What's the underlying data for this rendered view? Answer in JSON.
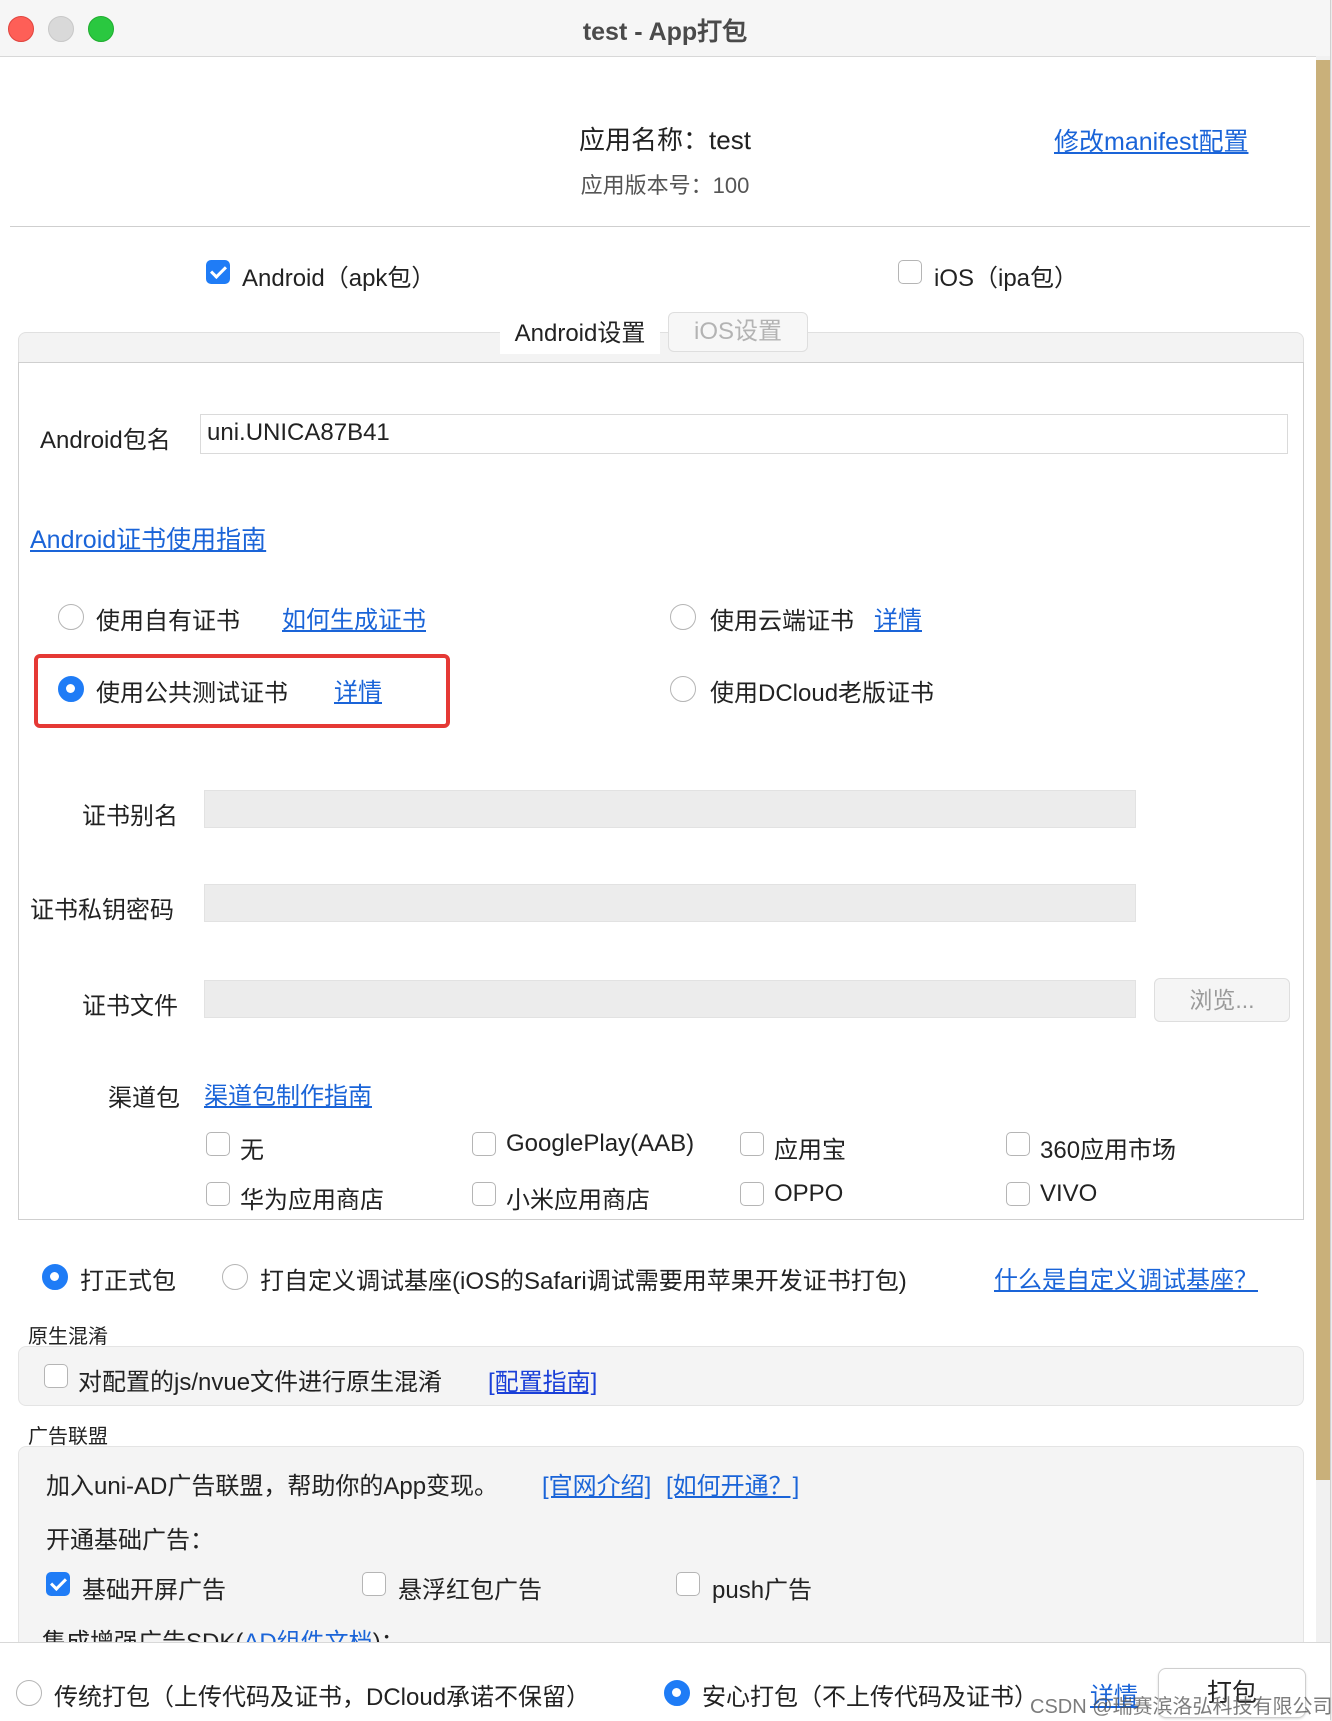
{
  "window": {
    "title": "test - App打包"
  },
  "app_info": {
    "name_line": "应用名称：test",
    "version_line": "应用版本号：100",
    "manifest_link": "修改manifest配置"
  },
  "platforms": {
    "android_label": "Android（apk包）",
    "android_checked": true,
    "ios_label": "iOS（ipa包）",
    "ios_checked": false
  },
  "tabs": {
    "android": "Android设置",
    "ios": "iOS设置"
  },
  "android": {
    "package_label": "Android包名",
    "package_value": "uni.UNICA87B41",
    "cert_guide_link": "Android证书使用指南",
    "cert_options": {
      "own": "使用自有证书",
      "own_link": "如何生成证书",
      "cloud": "使用云端证书",
      "cloud_link": "详情",
      "public_test": "使用公共测试证书",
      "public_test_link": "详情",
      "dcloud_old": "使用DCloud老版证书",
      "selected": "public_test"
    },
    "alias_label": "证书别名",
    "password_label": "证书私钥密码",
    "file_label": "证书文件",
    "browse_button": "浏览...",
    "channel_label": "渠道包",
    "channel_link": "渠道包制作指南",
    "channels": [
      {
        "label": "无",
        "checked": false
      },
      {
        "label": "GooglePlay(AAB)",
        "checked": false
      },
      {
        "label": "应用宝",
        "checked": false
      },
      {
        "label": "360应用市场",
        "checked": false
      },
      {
        "label": "华为应用商店",
        "checked": false
      },
      {
        "label": "小米应用商店",
        "checked": false
      },
      {
        "label": "OPPO",
        "checked": false
      },
      {
        "label": "VIVO",
        "checked": false
      }
    ]
  },
  "build_mode": {
    "release": "打正式包",
    "custom_base": "打自定义调试基座(iOS的Safari调试需要用苹果开发证书打包)",
    "custom_base_link": "什么是自定义调试基座？",
    "selected": "release"
  },
  "obfuscation": {
    "section_title": "原生混淆",
    "checkbox_label": "对配置的js/nvue文件进行原生混淆",
    "guide_link": "[配置指南]",
    "checked": false
  },
  "ads": {
    "section_title": "广告联盟",
    "intro": "加入uni-AD广告联盟，帮助你的App变现。",
    "intro_link": "[官网介绍]",
    "howto_link": "[如何开通？]",
    "basic_label": "开通基础广告：",
    "options": [
      {
        "label": "基础开屏广告",
        "checked": true
      },
      {
        "label": "悬浮红包广告",
        "checked": false
      },
      {
        "label": "push广告",
        "checked": false
      }
    ],
    "sdk_partial": "集成增强广告SDK(",
    "sdk_link": "AD组件文档",
    "sdk_partial_end": ")："
  },
  "footer": {
    "traditional": "传统打包（上传代码及证书，DCloud承诺不保留）",
    "safe": "安心打包（不上传代码及证书）",
    "safe_link": "详情",
    "pack_button": "打包",
    "selected": "safe"
  },
  "watermark": "CSDN @瑞赛滨洛弘科技有限公司",
  "colors": {
    "accent": "#1f7cf6",
    "link": "#1a64d8",
    "highlight_border": "#e53935"
  }
}
